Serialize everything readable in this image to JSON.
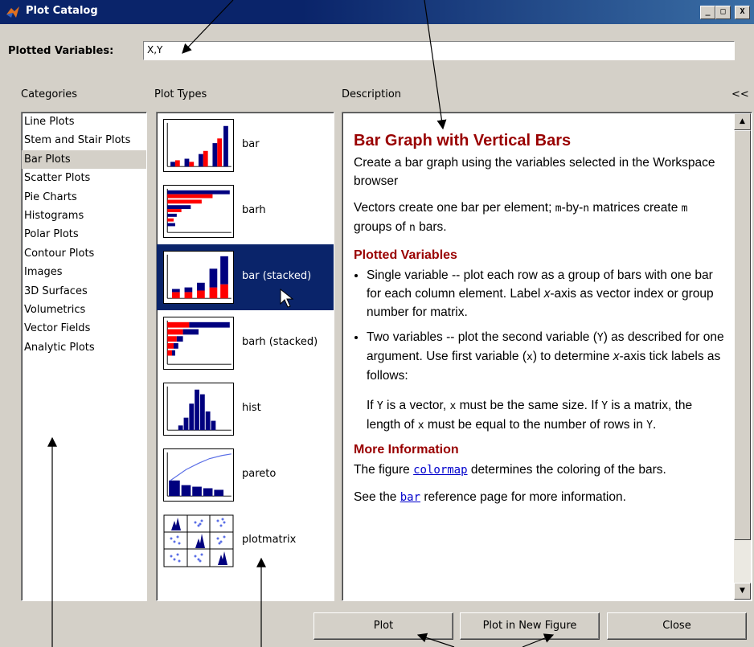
{
  "window": {
    "title": "Plot Catalog",
    "minimize_glyph": "_",
    "maximize_glyph": "□",
    "close_glyph": "X"
  },
  "plotted_variables": {
    "label": "Plotted Variables:",
    "value": "X,Y"
  },
  "headers": {
    "categories": "Categories",
    "plot_types": "Plot Types",
    "description": "Description",
    "collapse": "<<"
  },
  "categories": [
    "Line Plots",
    "Stem and Stair Plots",
    "Bar Plots",
    "Scatter Plots",
    "Pie Charts",
    "Histograms",
    "Polar Plots",
    "Contour Plots",
    "Images",
    "3D Surfaces",
    "Volumetrics",
    "Vector Fields",
    "Analytic Plots"
  ],
  "selected_category": "Bar Plots",
  "plot_types": [
    {
      "label": "bar",
      "icon": "bar-thumbnail-icon"
    },
    {
      "label": "barh",
      "icon": "barh-thumbnail-icon"
    },
    {
      "label": "bar (stacked)",
      "icon": "bar-stacked-thumbnail-icon"
    },
    {
      "label": "barh (stacked)",
      "icon": "barh-stacked-thumbnail-icon"
    },
    {
      "label": "hist",
      "icon": "hist-thumbnail-icon"
    },
    {
      "label": "pareto",
      "icon": "pareto-thumbnail-icon"
    },
    {
      "label": "plotmatrix",
      "icon": "plotmatrix-thumbnail-icon"
    }
  ],
  "selected_plot_type": "bar (stacked)",
  "description": {
    "title": "Bar Graph with Vertical Bars",
    "intro": "Create a bar graph using the variables selected in the Workspace browser",
    "vectors_a": "Vectors create one bar per element; ",
    "vectors_mono1": "m",
    "vectors_b": "-by-",
    "vectors_mono2": "n",
    "vectors_c": " matrices create ",
    "vectors_mono3": "m",
    "vectors_d": " groups of ",
    "vectors_mono4": "n",
    "vectors_e": " bars.",
    "plotted_heading": "Plotted Variables",
    "bullet1_a": "Single variable -- plot each row as a group of bars with one bar for each column element. Label ",
    "bullet1_x": "x",
    "bullet1_b": "-axis as vector index or group number for matrix.",
    "bullet2_a": "Two variables -- plot the second variable (",
    "bullet2_Y": "Y",
    "bullet2_b": ") as described for one argument. Use first variable (",
    "bullet2_x": "x",
    "bullet2_c": ") to determine ",
    "bullet2_xa": "x",
    "bullet2_d": "-axis tick labels as follows:",
    "rule_a": "If ",
    "rule_Y1": "Y",
    "rule_b": " is a vector, ",
    "rule_x1": "x",
    "rule_c": " must be the same size. If ",
    "rule_Y2": "Y",
    "rule_d": " is a matrix, the length of ",
    "rule_x2": "x",
    "rule_e": " must be equal to the number of rows in ",
    "rule_Y3": "Y",
    "rule_f": ".",
    "more_heading": "More Information",
    "more_a": "The figure ",
    "more_link": "colormap",
    "more_b": " determines the coloring of the bars.",
    "see_a": "See the ",
    "see_link": "bar",
    "see_b": " reference page for more information."
  },
  "buttons": {
    "plot": "Plot",
    "plot_new": "Plot in New Figure",
    "close": "Close"
  },
  "colors": {
    "selection": "#0a246a",
    "heading": "#990000",
    "bar_blue": "#00007f",
    "bar_red": "#ff0000"
  }
}
